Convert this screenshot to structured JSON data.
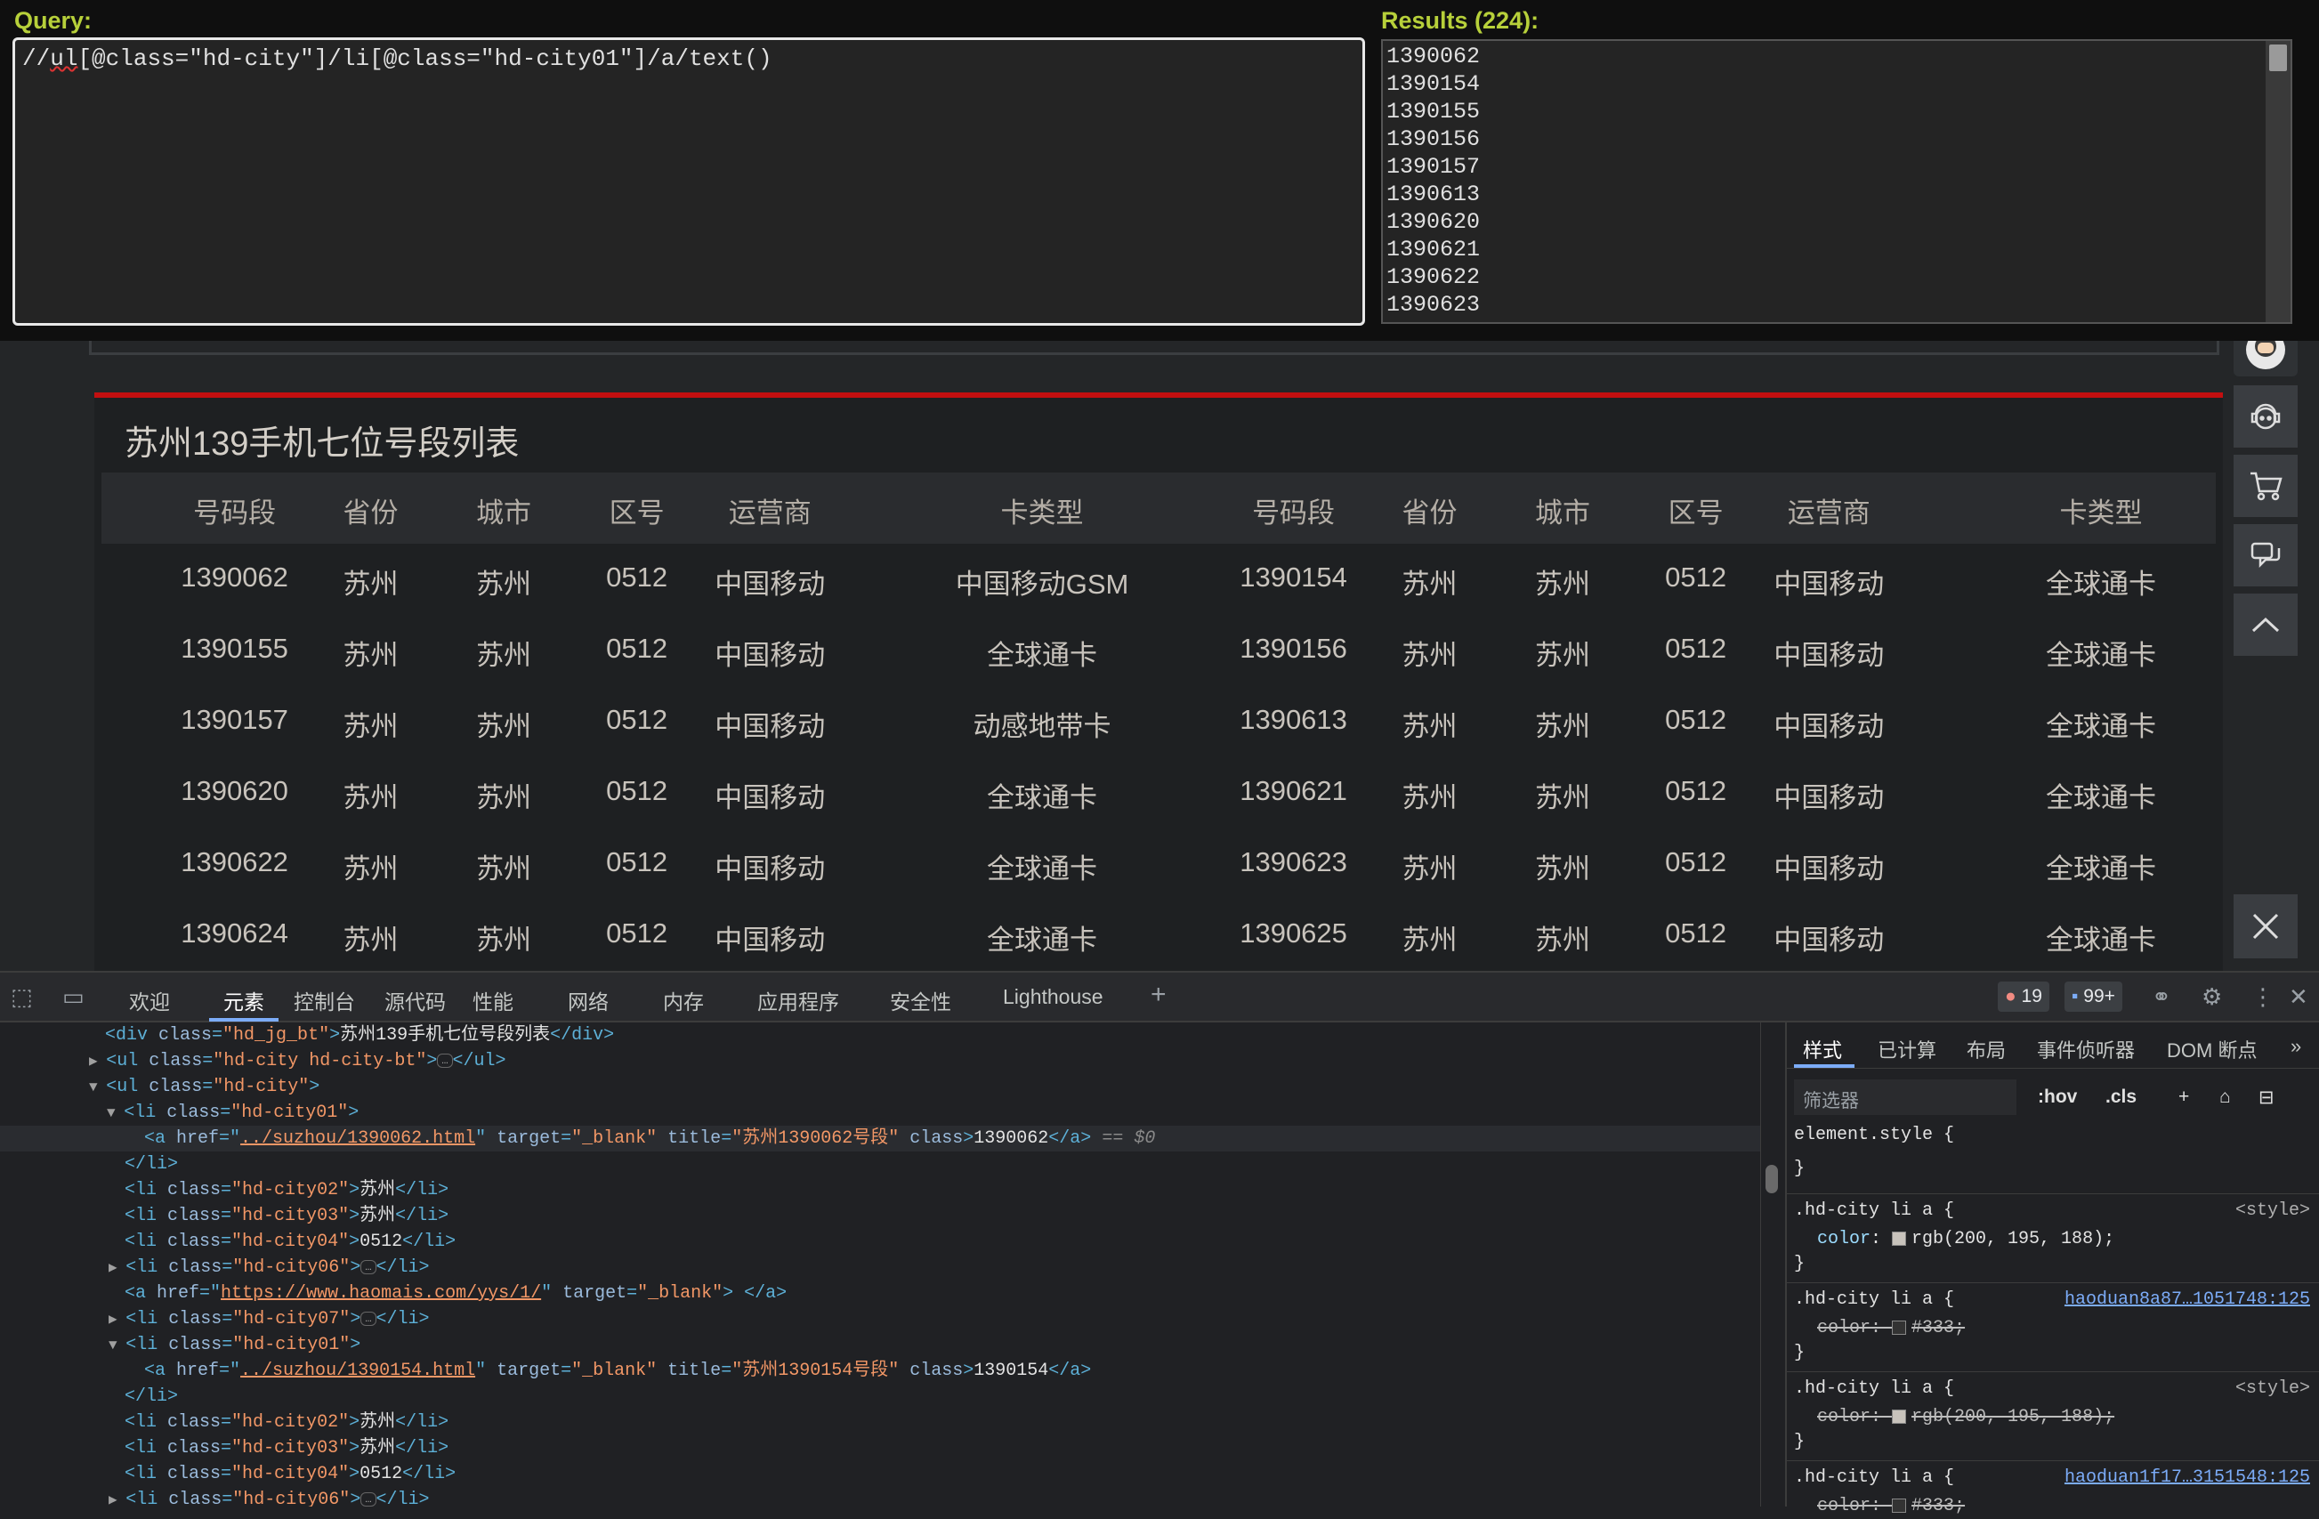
{
  "xpath_helper": {
    "query_label": "Query:",
    "query_prefix": "//",
    "query_ul": "ul",
    "query_rest": "[@class=\"hd-city\"]/li[@class=\"hd-city01\"]/a/text()",
    "results_label": "Results (224):",
    "results": [
      "1390062",
      "1390154",
      "1390155",
      "1390156",
      "1390157",
      "1390613",
      "1390620",
      "1390621",
      "1390622",
      "1390623"
    ]
  },
  "page": {
    "title": "苏州139手机七位号段列表",
    "headers": [
      "号码段",
      "省份",
      "城市",
      "区号",
      "运营商",
      "卡类型",
      "号码段",
      "省份",
      "城市",
      "区号",
      "运营商",
      "卡类型"
    ],
    "rows": [
      [
        "1390062",
        "苏州",
        "苏州",
        "0512",
        "中国移动",
        "中国移动GSM",
        "1390154",
        "苏州",
        "苏州",
        "0512",
        "中国移动",
        "全球通卡"
      ],
      [
        "1390155",
        "苏州",
        "苏州",
        "0512",
        "中国移动",
        "全球通卡",
        "1390156",
        "苏州",
        "苏州",
        "0512",
        "中国移动",
        "全球通卡"
      ],
      [
        "1390157",
        "苏州",
        "苏州",
        "0512",
        "中国移动",
        "动感地带卡",
        "1390613",
        "苏州",
        "苏州",
        "0512",
        "中国移动",
        "全球通卡"
      ],
      [
        "1390620",
        "苏州",
        "苏州",
        "0512",
        "中国移动",
        "全球通卡",
        "1390621",
        "苏州",
        "苏州",
        "0512",
        "中国移动",
        "全球通卡"
      ],
      [
        "1390622",
        "苏州",
        "苏州",
        "0512",
        "中国移动",
        "全球通卡",
        "1390623",
        "苏州",
        "苏州",
        "0512",
        "中国移动",
        "全球通卡"
      ],
      [
        "1390624",
        "苏州",
        "苏州",
        "0512",
        "中国移动",
        "全球通卡",
        "1390625",
        "苏州",
        "苏州",
        "0512",
        "中国移动",
        "全球通卡"
      ]
    ],
    "toolbar_icons": [
      "avatar-icon",
      "service-icon",
      "cart-icon",
      "chat-icon",
      "back-to-top-icon",
      "close-icon"
    ]
  },
  "devtools": {
    "tabs": [
      "欢迎",
      "元素",
      "控制台",
      "源代码",
      "性能",
      "网络",
      "内存",
      "应用程序",
      "安全性",
      "Lighthouse"
    ],
    "active_tab": "元素",
    "error_count": "19",
    "message_count": "99+",
    "dom": {
      "l1_tag_open": "<div",
      "l1_attr": "class",
      "l1_val": "\"hd_jg_bt\"",
      "l1_text": "苏州139手机七位号段列表",
      "l1_close": "</div>",
      "l2_val": "\"hd-city hd-city-bt\"",
      "l3_val": "\"hd-city\"",
      "li01": "\"hd-city01\"",
      "li02": "\"hd-city02\"",
      "li03": "\"hd-city03\"",
      "li04": "\"hd-city04\"",
      "li06": "\"hd-city06\"",
      "li07": "\"hd-city07\"",
      "a1_href": "../suzhou/1390062.html",
      "a1_title": "\"苏州1390062号段\"",
      "a1_text": "1390062",
      "a2_href": "../suzhou/1390154.html",
      "a2_title": "\"苏州1390154号段\"",
      "a2_text": "1390154",
      "ext_href": "https://www.haomais.com/yys/1/",
      "target": "\"_blank\"",
      "city": "苏州",
      "code": "0512",
      "selected_marker": "== $0"
    },
    "styles": {
      "tabs": [
        "样式",
        "已计算",
        "布局",
        "事件侦听器",
        "DOM 断点"
      ],
      "filter_placeholder": "筛选器",
      "hov": ":hov",
      "cls": ".cls",
      "element_style": "element.style {",
      "close_brace": "}",
      "selector": ".hd-city li a {",
      "src_style": "<style>",
      "src_link1": "haoduan8a87…1051748:125",
      "src_link2": "haoduan1f17…3151548:125",
      "prop_color": "color",
      "val_rgb": "rgb(200, 195, 188);",
      "val_333": "#333;"
    }
  }
}
